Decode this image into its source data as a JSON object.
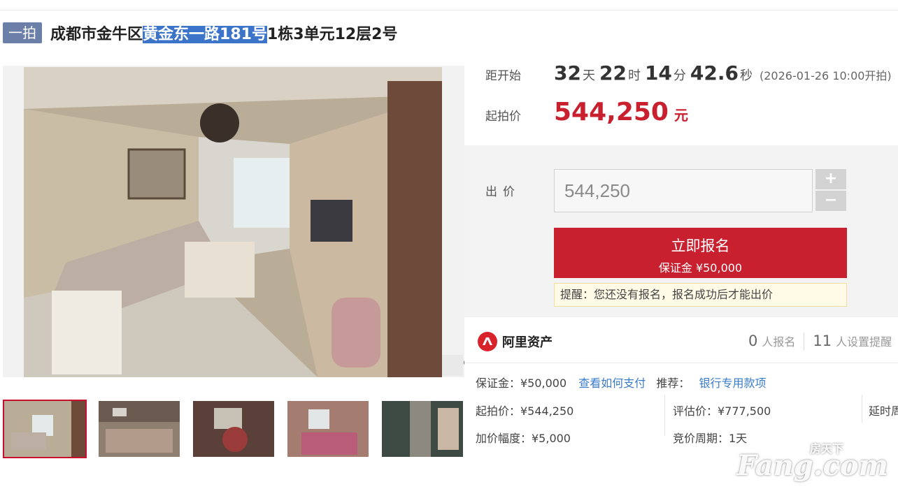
{
  "title": {
    "round_tag": "一拍",
    "prefix": "成都市金牛区",
    "highlight": "黄金东一路181号",
    "suffix": "1栋3单元12层2号"
  },
  "countdown": {
    "label": "距开始",
    "days": "32",
    "days_unit": "天",
    "hours": "22",
    "hours_unit": "时",
    "minutes": "14",
    "minutes_unit": "分",
    "seconds": "42.6",
    "seconds_unit": "秒",
    "start_note": "(2026-01-26 10:00开拍)"
  },
  "start_price": {
    "label": "起拍价",
    "value": "544,250",
    "unit": "元"
  },
  "bid": {
    "label": "出价",
    "input_value": "544,250",
    "plus": "+",
    "minus": "−",
    "signup_label": "立即报名",
    "deposit_label": "保证金 ¥50,000",
    "notice": "提醒：您还没有报名，报名成功后才能出价"
  },
  "brand": {
    "name": "阿里资产"
  },
  "stats": {
    "registered_count": "0",
    "registered_label": "人报名",
    "reminder_count": "11",
    "reminder_label": "人设置提醒"
  },
  "info": {
    "deposit": "保证金：¥50,000",
    "how_to_pay_link": "查看如何支付",
    "recommend_label": "推荐：",
    "recommend_link": "银行专用款项",
    "start_price": "起拍价：¥544,250",
    "appraisal": "评估价：¥777,500",
    "delay": "延时周期",
    "increment": "加价幅度：¥5,000",
    "cycle": "竞价周期：1天"
  },
  "watermark": {
    "text": "Fang.com",
    "sub": "房天下"
  },
  "colors": {
    "accent_red": "#c8202f",
    "link_blue": "#3a7bc8",
    "tag_bg": "#6b7fa8"
  }
}
